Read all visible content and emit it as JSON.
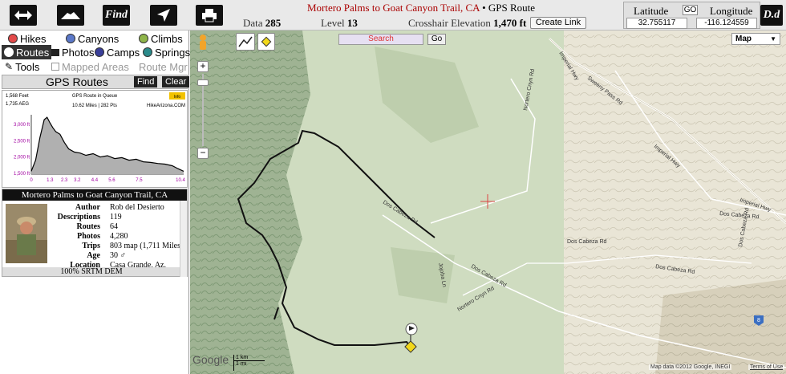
{
  "toolbar": {
    "find_label": "Find",
    "dd_label": "D.d"
  },
  "header": {
    "route_name": "Mortero Palms to Goat Canyon Trail, CA",
    "separator": "•",
    "page_type": "GPS Route",
    "data_label": "Data",
    "data_value": "285",
    "level_label": "Level",
    "level_value": "13",
    "elevation_label": "Crosshair Elevation",
    "elevation_value": "1,470 ft",
    "create_link": "Create Link"
  },
  "coords": {
    "lat_label": "Latitude",
    "go_label": "GO",
    "lon_label": "Longitude",
    "lat_value": "32.755117",
    "lon_value": "-116.124559"
  },
  "categories": {
    "hikes": "Hikes",
    "canyons": "Canyons",
    "climbs": "Climbs",
    "routes": "Routes",
    "photos": "Photos",
    "camps": "Camps",
    "springs": "Springs",
    "tools": "Tools",
    "mapped_areas": "Mapped Areas",
    "route_mgr": "Route Mgr"
  },
  "gps_routes": {
    "title": "GPS Routes",
    "find": "Find",
    "clear": "Clear"
  },
  "chart_data": {
    "type": "area",
    "title": "GPS Route in Queue",
    "subtitle": "10.62 Miles | 282 Pts",
    "credit": "HikeArizona.COM",
    "info": "Info",
    "stat_feet": "1,568 Feet",
    "stat_aeg": "1,735 AEG",
    "x_ticks": [
      "0",
      "1.3",
      "2.3",
      "3.2",
      "4.4",
      "5.6",
      "7.5",
      "10.4"
    ],
    "y_ticks": [
      "1,500 ft",
      "2,000 ft",
      "2,500 ft",
      "3,000 ft"
    ],
    "ylim": [
      1470,
      3300
    ],
    "xlim": [
      0,
      10.6
    ],
    "x": [
      0,
      0.3,
      0.6,
      0.9,
      1.1,
      1.3,
      1.5,
      1.7,
      2.0,
      2.3,
      2.6,
      3.0,
      3.4,
      3.8,
      4.3,
      4.8,
      5.3,
      5.8,
      6.3,
      6.8,
      7.3,
      7.8,
      8.3,
      8.8,
      9.3,
      9.8,
      10.2,
      10.6
    ],
    "y": [
      1560,
      1900,
      2600,
      3150,
      3220,
      3050,
      2900,
      2780,
      2700,
      2450,
      2250,
      2150,
      2120,
      2050,
      2100,
      2000,
      2040,
      1950,
      1980,
      1900,
      1930,
      1850,
      1830,
      1800,
      1780,
      1730,
      1640,
      1560
    ],
    "colors": {
      "line": "#000000",
      "fill": "#b0b0b0",
      "axis_label": "#a000a0"
    }
  },
  "author_card": {
    "header": "Mortero Palms to Goat Canyon Trail, CA",
    "rows": [
      {
        "k": "Author",
        "v": "Rob del Desierto"
      },
      {
        "k": "Descriptions",
        "v": "119"
      },
      {
        "k": "Routes",
        "v": "64"
      },
      {
        "k": "Photos",
        "v": "4,280"
      },
      {
        "k": "Trips",
        "v": "803 map (1,711 Miles)"
      },
      {
        "k": "Age",
        "v": "30 ♂"
      },
      {
        "k": "Location",
        "v": "Casa Grande, Az."
      }
    ],
    "footer": "100% SRTM DEM"
  },
  "map": {
    "search_placeholder": "Search",
    "go": "Go",
    "map_type": "Map",
    "labels": {
      "imperial_hwy_1": "Imperial Hwy",
      "imperial_hwy_2": "Imperial Hwy",
      "imperial_hwy_3": "Imperial Hwy",
      "sweeny_pass": "Sweeny Pass Rd",
      "nortero_cnyn_1": "Nortero Cnyn Rd",
      "nortero_cnyn_2": "Nortero Cnyn Rd",
      "dos_cabeza_1": "Dos Cabeza Rd",
      "dos_cabeza_2": "Dos Cabeza Rd",
      "dos_cabeza_3": "Dos Cabeza Rd",
      "dos_cabeza_4": "Dos Cabeza Rd",
      "dos_cabeza_5": "Dos Cabeza Rd",
      "dos_cabeza_6": "Dos Cabeza Rd",
      "jojoba": "Jojoba Ln",
      "route_8": "8"
    },
    "scale_km": "1 km",
    "scale_mi": "1 mi",
    "google": "Google",
    "attribution": "Map data ©2012 Google, INEGI",
    "terms": "Terms of Use"
  }
}
